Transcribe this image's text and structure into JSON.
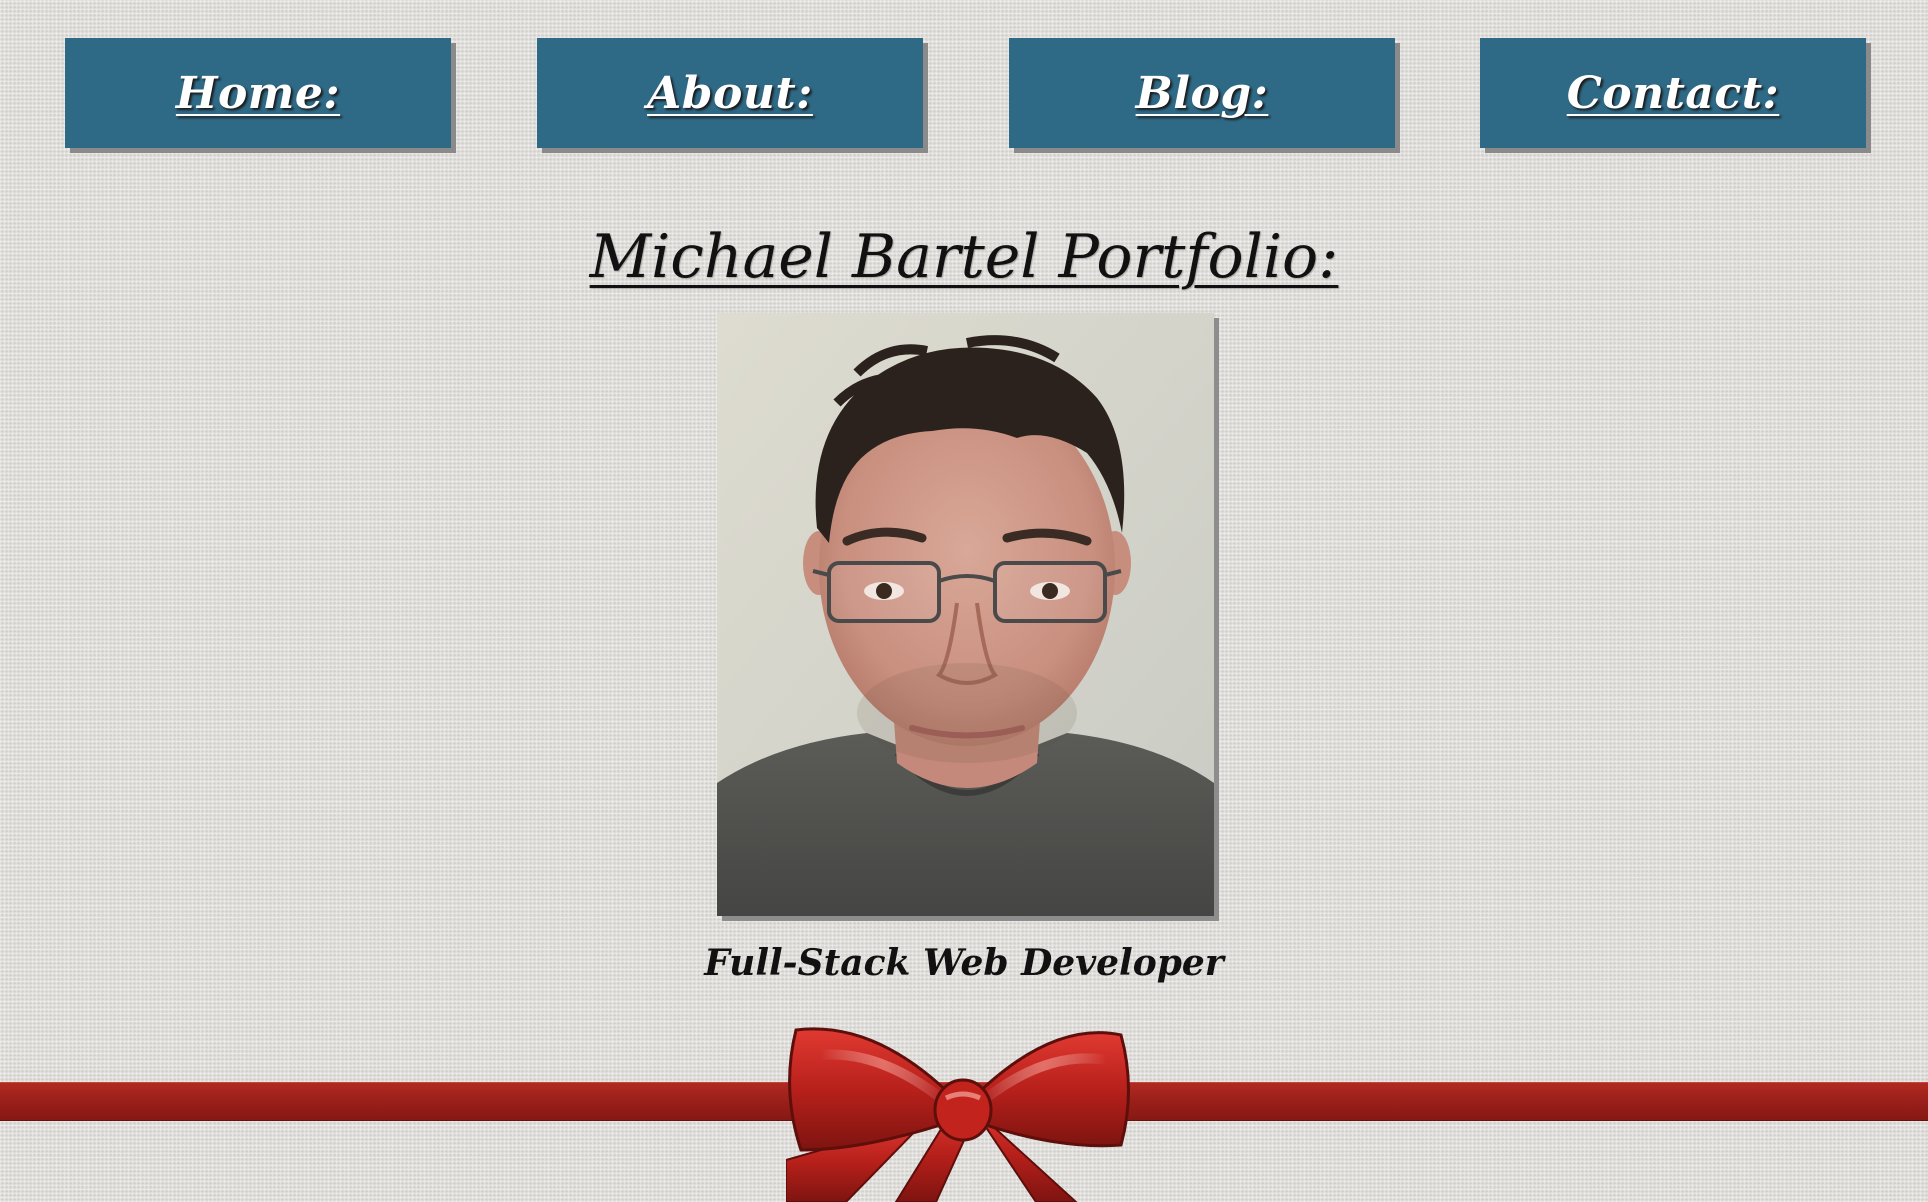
{
  "nav": {
    "items": [
      {
        "label": "Home:"
      },
      {
        "label": "About:"
      },
      {
        "label": "Blog:"
      },
      {
        "label": "Contact:"
      }
    ]
  },
  "main": {
    "title": "Michael Bartel Portfolio:",
    "subtitle": "Full-Stack Web Developer"
  },
  "colors": {
    "nav_button": "#2e6986",
    "ribbon": "#9a1f1a",
    "background": "#e2e0dc"
  },
  "icons": {
    "bow": "red-ribbon-bow-icon"
  }
}
